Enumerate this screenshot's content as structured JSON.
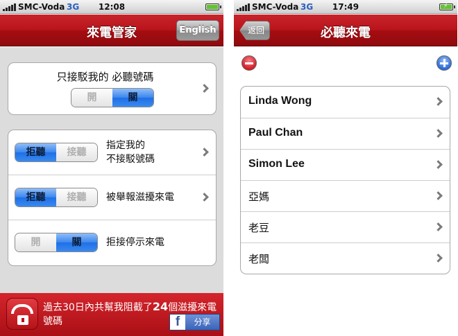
{
  "left": {
    "status": {
      "carrier": "SMC-Voda",
      "network": "3G",
      "time": "12:08"
    },
    "nav": {
      "title": "來電管家",
      "english_button": "English"
    },
    "group1": {
      "label": "只接駁我的 必聽號碼",
      "toggle_on": "開",
      "toggle_off": "關",
      "state": "off"
    },
    "group2": [
      {
        "reject": "拒聽",
        "accept": "接聽",
        "state": "reject",
        "label_line1": "指定我的",
        "label_line2": "不接駁號碼"
      },
      {
        "reject": "拒聽",
        "accept": "接聽",
        "state": "reject",
        "label_line1": "被舉報滋擾來電",
        "label_line2": ""
      },
      {
        "on": "開",
        "off": "關",
        "state": "off",
        "label_line1": "拒接停示來電",
        "label_line2": ""
      }
    ],
    "bottom": {
      "message_before": "過去30日內共幫我阻截了",
      "count": "24",
      "message_after": "個滋擾來電號碼",
      "share_label": "分享",
      "fb_letter": "f"
    }
  },
  "right": {
    "status": {
      "carrier": "SMC-Voda",
      "network": "3G",
      "time": "17:49"
    },
    "nav": {
      "title": "必聽來電",
      "back_button": "返回"
    },
    "contacts": [
      {
        "name": "Linda Wong"
      },
      {
        "name": "Paul Chan"
      },
      {
        "name": "Simon Lee"
      },
      {
        "name": "亞媽"
      },
      {
        "name": "老豆"
      },
      {
        "name": "老闆"
      }
    ]
  },
  "colors": {
    "accent_red": "#b9141b",
    "toggle_blue": "#2a78ea",
    "group_bg": "#dcdcdc"
  },
  "icons": [
    "signal-icon",
    "battery-icon",
    "chevron-right-icon",
    "minus-icon",
    "plus-icon",
    "call-block-lock-icon",
    "facebook-icon"
  ]
}
